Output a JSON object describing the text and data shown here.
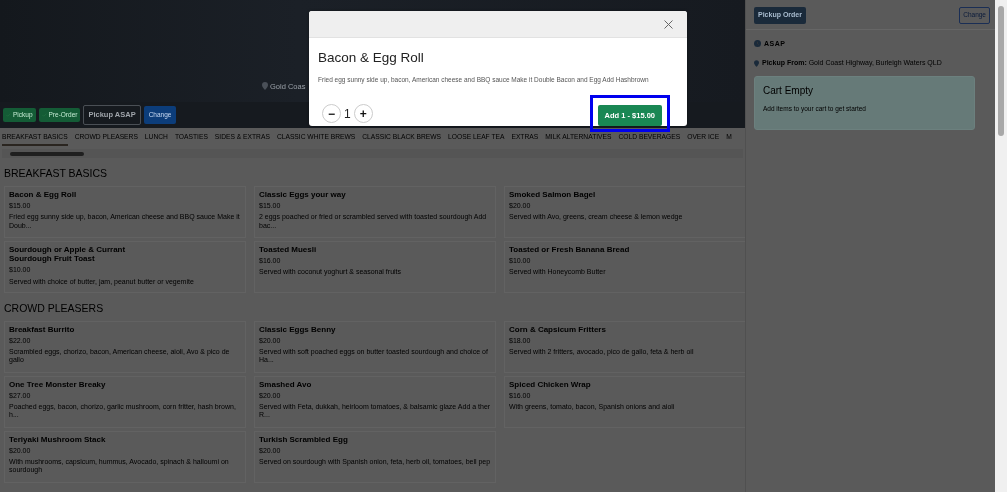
{
  "hero": {
    "location": "Gold Coas"
  },
  "order_bar": {
    "tags": [
      {
        "label": "Pickup"
      },
      {
        "label": "Pre-Order"
      }
    ],
    "mode": "Pickup ASAP",
    "change": "Change"
  },
  "categories": [
    {
      "label": "BREAKFAST BASICS",
      "selected": true
    },
    {
      "label": "CROWD PLEASERS",
      "selected": false
    },
    {
      "label": "LUNCH",
      "selected": false
    },
    {
      "label": "TOASTIES",
      "selected": false
    },
    {
      "label": "SIDES & EXTRAS",
      "selected": false
    },
    {
      "label": "CLASSIC WHITE BREWS",
      "selected": false
    },
    {
      "label": "CLASSIC BLACK BREWS",
      "selected": false
    },
    {
      "label": "LOOSE LEAF TEA",
      "selected": false
    },
    {
      "label": "EXTRAS",
      "selected": false
    },
    {
      "label": "MILK ALTERNATIVES",
      "selected": false
    },
    {
      "label": "COLD BEVERAGES",
      "selected": false
    },
    {
      "label": "OVER ICE",
      "selected": false
    },
    {
      "label": "M",
      "selected": false
    }
  ],
  "sections": [
    {
      "title": "BREAKFAST BASICS",
      "items": [
        {
          "name": "Bacon & Egg Roll",
          "price": "$15.00",
          "description": "Fried egg sunny side up, bacon, American cheese and BBQ sauce Make it Doub..."
        },
        {
          "name": "Classic Eggs your way",
          "price": "$15.00",
          "description": "2 eggs poached or fried or scrambled served with toasted sourdough Add bac..."
        },
        {
          "name": "Smoked Salmon Bagel",
          "price": "$20.00",
          "description": "Served with Avo, greens, cream cheese & lemon wedge"
        },
        {
          "name": "Sourdough or Apple & Currant Sourdough Fruit Toast",
          "price": "$10.00",
          "description": "Served with choice of butter, jam, peanut butter or vegemite"
        },
        {
          "name": "Toasted Muesli",
          "price": "$16.00",
          "description": "Served with coconut yoghurt & seasonal fruits"
        },
        {
          "name": "Toasted or Fresh Banana Bread",
          "price": "$10.00",
          "description": "Served with Honeycomb Butter"
        }
      ]
    },
    {
      "title": "CROWD PLEASERS",
      "items": [
        {
          "name": "Breakfast Burrito",
          "price": "$22.00",
          "description": "Scrambled eggs, chorizo, bacon, American cheese, aioli, Avo & pico de gallo"
        },
        {
          "name": "Classic Eggs Benny",
          "price": "$20.00",
          "description": "Served with soft poached eggs on butter toasted sourdough and choice of Ha..."
        },
        {
          "name": "Corn & Capsicum Fritters",
          "price": "$18.00",
          "description": "Served with 2 fritters, avocado, pico de gallo, feta & herb oil"
        },
        {
          "name": "One Tree Monster Breaky",
          "price": "$27.00",
          "description": "Poached eggs, bacon, chorizo, garlic mushroom, corn fritter, hash brown, h..."
        },
        {
          "name": "Smashed Avo",
          "price": "$20.00",
          "description": "Served with Feta, dukkah, heirloom tomatoes, & balsamic glaze Add a ther R..."
        },
        {
          "name": "Spiced Chicken Wrap",
          "price": "$16.00",
          "description": "With greens, tomato, bacon, Spanish onions and aioli"
        },
        {
          "name": "Teriyaki Mushroom Stack",
          "price": "$20.00",
          "description": "With mushrooms, capsicum, hummus, Avocado, spinach & halloumi on sourdough"
        },
        {
          "name": "Turkish Scrambled Egg",
          "price": "$20.00",
          "description": "Served on sourdough with Spanish onion, feta, herb oil, tomatoes, bell pep"
        }
      ]
    }
  ],
  "sidebar": {
    "order_type": "Pickup Order",
    "change": "Change",
    "time": "ASAP",
    "pickup": "**Pickup From:** Gold Coast Highway, Burleigh Waters QLD",
    "cart": {
      "title": "Cart Empty",
      "message": "Add items to your cart to get started"
    }
  },
  "modal": {
    "title": "Bacon & Egg Roll",
    "description": "Fried egg sunny side up, bacon, American cheese and BBQ sauce Make it Double Bacon and Egg Add Hashbrown",
    "decrement": "−",
    "quantity": "1",
    "increment": "+",
    "add_button": "Add 1 - $15.00",
    "highlighted": true
  }
}
